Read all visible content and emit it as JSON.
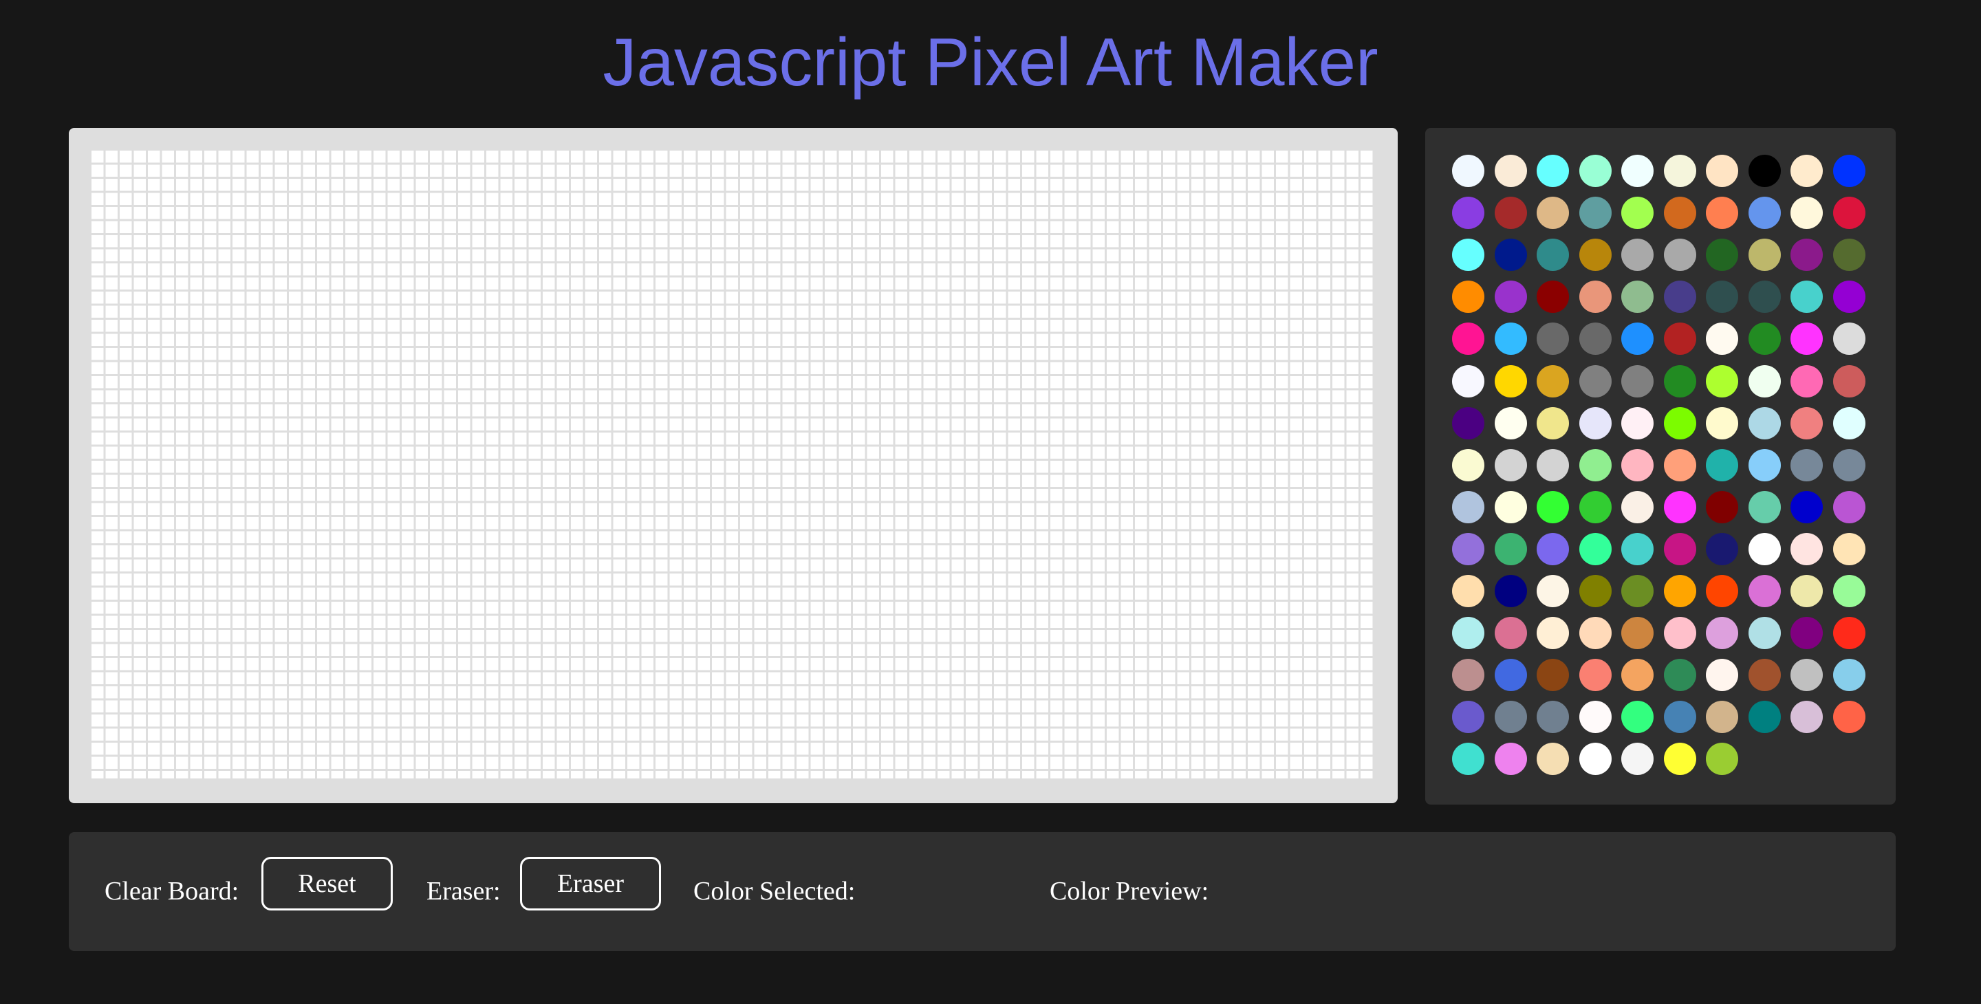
{
  "title": "Javascript Pixel Art Maker",
  "board": {
    "columns": 92,
    "rows": 45,
    "cell_color": "#ffffff",
    "grid_line_color": "#dedede"
  },
  "controls": {
    "clear_label": "Clear Board:",
    "reset_button": "Reset",
    "eraser_label": "Eraser:",
    "eraser_button": "Eraser",
    "color_selected_label": "Color Selected:",
    "color_selected_value": "",
    "color_preview_label": "Color Preview:"
  },
  "palette": {
    "columns": 10,
    "colors": [
      "#f0f8ff",
      "#faebd7",
      "#66ffff",
      "#99ffd5",
      "#f0ffff",
      "#f5f5dc",
      "#ffe4c4",
      "#000000",
      "#ffebcd",
      "#0033ff",
      "#8a3de2",
      "#a52a2a",
      "#deb887",
      "#5f9ea0",
      "#a2ff4f",
      "#d2691e",
      "#ff7f50",
      "#6495ed",
      "#fff8dc",
      "#dc143c",
      "#66ffff",
      "#001a8c",
      "#2f8b8b",
      "#b8860b",
      "#a9a9a9",
      "#a9a9a9",
      "#226622",
      "#bdb76b",
      "#8b1a8b",
      "#556b2f",
      "#ff8c00",
      "#9932cc",
      "#8b0000",
      "#e9967a",
      "#8fbc8f",
      "#483d8b",
      "#2f4f4f",
      "#2f4f4f",
      "#48d1cc",
      "#9400d3",
      "#ff1493",
      "#33bbff",
      "#696969",
      "#696969",
      "#1e90ff",
      "#b22222",
      "#fffaf0",
      "#228b22",
      "#ff33ff",
      "#dcdcdc",
      "#f8f8ff",
      "#ffd700",
      "#daa520",
      "#808080",
      "#808080",
      "#228b22",
      "#adff2f",
      "#f0fff0",
      "#ff69b4",
      "#cd5c5c",
      "#4b0082",
      "#fffff0",
      "#f0e68c",
      "#e6e6fa",
      "#fff0f5",
      "#7cfc00",
      "#fffacd",
      "#add8e6",
      "#f08080",
      "#e0ffff",
      "#fafad2",
      "#d3d3d3",
      "#d3d3d3",
      "#90ee90",
      "#ffb6c1",
      "#ffa07a",
      "#20b2aa",
      "#87cefa",
      "#778899",
      "#778899",
      "#b0c4de",
      "#ffffe0",
      "#33ff33",
      "#32cd32",
      "#faf0e6",
      "#ff33ff",
      "#800000",
      "#66cdaa",
      "#0000cd",
      "#ba55d3",
      "#9370db",
      "#3cb371",
      "#7b68ee",
      "#33ff9a",
      "#48d1cc",
      "#c71585",
      "#191970",
      "#ffffff",
      "#ffe4e1",
      "#ffe4b5",
      "#ffdead",
      "#000080",
      "#fdf5e6",
      "#808000",
      "#6b8e23",
      "#ffa500",
      "#ff4500",
      "#da70d6",
      "#eee8aa",
      "#98fb98",
      "#afeeee",
      "#db7093",
      "#ffefd5",
      "#ffdab9",
      "#cd853f",
      "#ffc0cb",
      "#dda0dd",
      "#b0e0e6",
      "#800080",
      "#ff2a1a",
      "#bc8f8f",
      "#4169e1",
      "#8b4513",
      "#fa8072",
      "#f4a460",
      "#2e8b57",
      "#fff5ee",
      "#a0522d",
      "#c0c0c0",
      "#87ceeb",
      "#6a5acd",
      "#708090",
      "#708090",
      "#fffafa",
      "#33ff7f",
      "#4682b4",
      "#d2b48c",
      "#008080",
      "#d8bfd8",
      "#ff6347",
      "#40e0d0",
      "#ee82ee",
      "#f5deb3",
      "#ffffff",
      "#f5f5f5",
      "#ffff33",
      "#9acd32"
    ]
  }
}
